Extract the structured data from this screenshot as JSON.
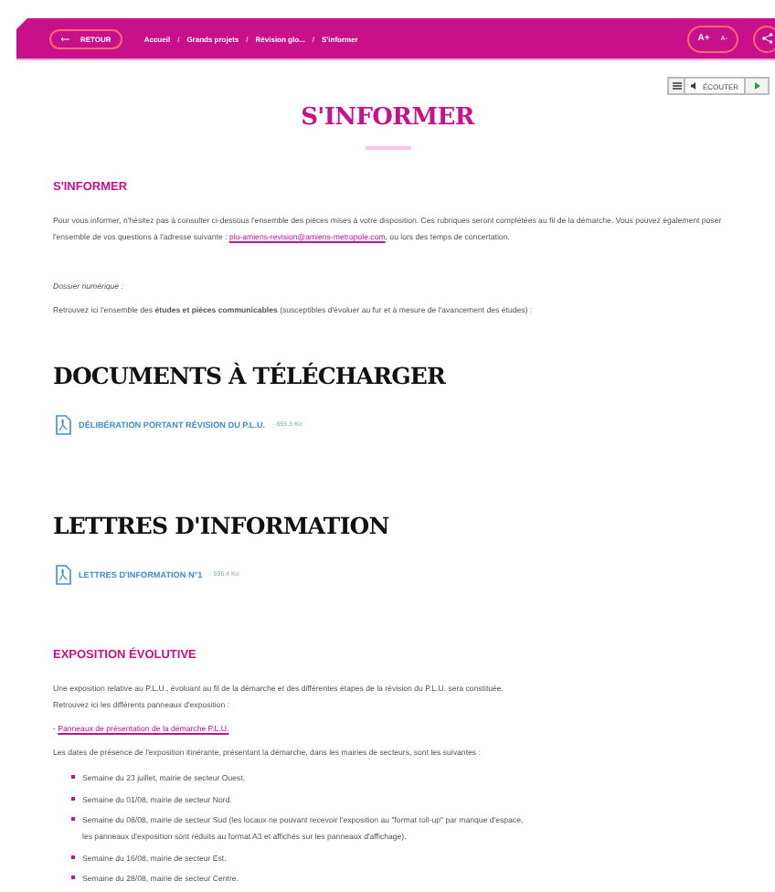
{
  "header": {
    "back": "RETOUR",
    "breadcrumbs": [
      "Accueil",
      "Grands projets",
      "Révision glo...",
      "S'informer"
    ],
    "breadcrumb_separator": "/",
    "font_size": [
      "A+",
      "A-"
    ]
  },
  "listen": {
    "label": "ÉCOUTER"
  },
  "title": "S'INFORMER",
  "intro": {
    "heading": "S'INFORMER",
    "paragraph_before": "Pour vous informer, n'hésitez pas à consulter ci-dessous l'ensemble des pièces mises à votre disposition. Ces rubriques seront complétées au fil de la démarche. Vous pouvez également poser l'ensemble de vos questions à l'adresse suivante :",
    "email": "plu-amiens-revision@amiens-metropole.com",
    "paragraph_after": ", ou lors des temps de concertation.",
    "note": "Dossier numérique :",
    "text": "Retrouvez ici l'ensemble des **études et pièces communicables** (susceptibles d'évoluer au fur et à mesure de l'avancement des études) :"
  },
  "sections": [
    {
      "heading": "DOCUMENTS À TÉLÉCHARGER",
      "files": [
        {
          "name": "DÉLIBÉRATION PORTANT RÉVISION DU P.L.U.",
          "size": "- 655.3 Ko"
        }
      ]
    },
    {
      "heading": "LETTRES D'INFORMATION",
      "files": [
        {
          "name": "LETTRES D'INFORMATION N°1",
          "size": "- 596.4 Ko"
        }
      ]
    }
  ],
  "exposition": {
    "heading": "EXPOSITION ÉVOLUTIVE",
    "text": "Une exposition relative au P.L.U., évoluant au fil de la démarche et des différentes étapes de la révision du P.L.U. sera constituée. Retrouvez ici les différents panneaux d'exposition :",
    "link_prefix": "- ",
    "link": "Panneaux de présentation de la démarche P.L.U.",
    "dates_text": "Les dates de présence de l'exposition itinérante, présentant la démarche, dans les mairies de secteurs, sont les suivantes :",
    "items": [
      "Semaine du 23 juillet, mairie de secteur Ouest.",
      "Semaine du 01/08, mairie de secteur Nord.",
      "Semaine du 08/08, mairie de secteur Sud (les locaux ne pouvant recevoir l'exposition au \"format roll-up\" par manque d'espace, les panneaux d'exposition sont réduits au format A3 et affichés sur les panneaux d'affichage).",
      "Semaine du 16/08, mairie de secteur Est.",
      "Semaine du 28/08, mairie de secteur Centre."
    ]
  }
}
